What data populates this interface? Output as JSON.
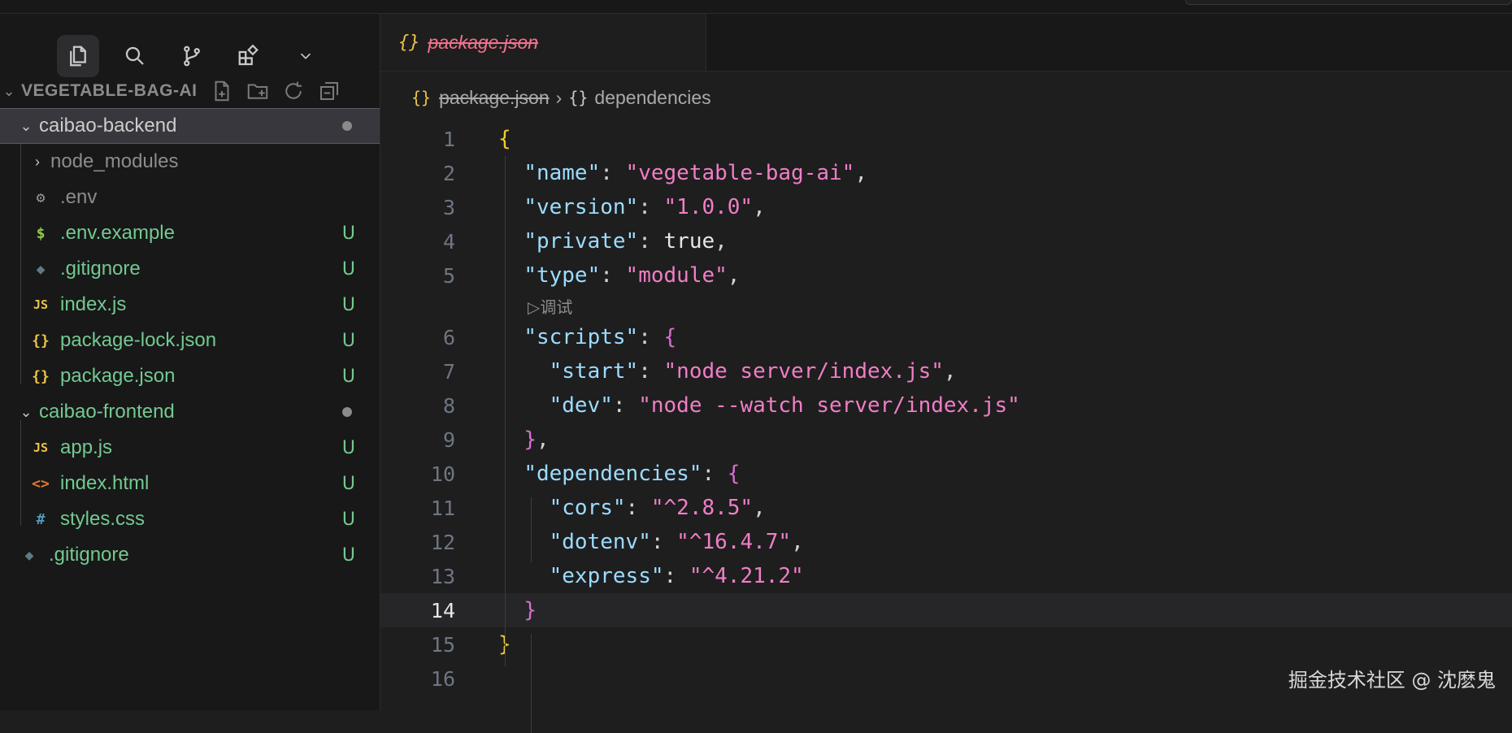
{
  "explorer": {
    "title": "VEGETABLE-BAG-AI"
  },
  "tree": [
    {
      "label": "caibao-backend",
      "badge": "",
      "kind": "folder-open",
      "icon": "chevron-down",
      "level": 0,
      "selected": true,
      "dot": true
    },
    {
      "label": "node_modules",
      "badge": "",
      "kind": "folder",
      "icon": "chevron-right",
      "level": 1,
      "dimmed": true
    },
    {
      "label": ".env",
      "badge": "",
      "kind": "file",
      "icon": "gear-icon",
      "level": 1,
      "dimmed": true
    },
    {
      "label": ".env.example",
      "badge": "U",
      "kind": "file",
      "icon": "dollar-icon",
      "level": 1
    },
    {
      "label": ".gitignore",
      "badge": "U",
      "kind": "file",
      "icon": "git-icon",
      "level": 1
    },
    {
      "label": "index.js",
      "badge": "U",
      "kind": "file",
      "icon": "js-icon",
      "level": 1
    },
    {
      "label": "package-lock.json",
      "badge": "U",
      "kind": "file",
      "icon": "json-icon",
      "level": 1
    },
    {
      "label": "package.json",
      "badge": "U",
      "kind": "file",
      "icon": "json-icon",
      "level": 1
    },
    {
      "label": "caibao-frontend",
      "badge": "",
      "kind": "folder-open",
      "icon": "chevron-down",
      "level": 0,
      "dot": true
    },
    {
      "label": "app.js",
      "badge": "U",
      "kind": "file",
      "icon": "js-icon",
      "level": 1
    },
    {
      "label": "index.html",
      "badge": "U",
      "kind": "file",
      "icon": "html-icon",
      "level": 1
    },
    {
      "label": "styles.css",
      "badge": "U",
      "kind": "file",
      "icon": "css-icon",
      "level": 1
    },
    {
      "label": ".gitignore",
      "badge": "U",
      "kind": "file",
      "icon": "git-icon",
      "level": 0
    }
  ],
  "tab": {
    "icon": "{}",
    "label": "package.json"
  },
  "breadcrumb": {
    "file_icon": "{}",
    "file": "package.json",
    "symbol_icon": "{}",
    "symbol": "dependencies"
  },
  "codelens": "▷调试",
  "lines": [
    {
      "n": "1",
      "tokens": [
        [
          "b1",
          "{"
        ]
      ]
    },
    {
      "n": "2",
      "tokens": [
        [
          "p",
          "  "
        ],
        [
          "k",
          "\"name\""
        ],
        [
          "p",
          ": "
        ],
        [
          "s",
          "\"vegetable-bag-ai\""
        ],
        [
          "p",
          ","
        ]
      ]
    },
    {
      "n": "3",
      "tokens": [
        [
          "p",
          "  "
        ],
        [
          "k",
          "\"version\""
        ],
        [
          "p",
          ": "
        ],
        [
          "s",
          "\"1.0.0\""
        ],
        [
          "p",
          ","
        ]
      ]
    },
    {
      "n": "4",
      "tokens": [
        [
          "p",
          "  "
        ],
        [
          "k",
          "\"private\""
        ],
        [
          "p",
          ": "
        ],
        [
          "v",
          "true"
        ],
        [
          "p",
          ","
        ]
      ]
    },
    {
      "n": "5",
      "tokens": [
        [
          "p",
          "  "
        ],
        [
          "k",
          "\"type\""
        ],
        [
          "p",
          ": "
        ],
        [
          "s",
          "\"module\""
        ],
        [
          "p",
          ","
        ]
      ],
      "codelens_after": true
    },
    {
      "n": "6",
      "tokens": [
        [
          "p",
          "  "
        ],
        [
          "k",
          "\"scripts\""
        ],
        [
          "p",
          ": "
        ],
        [
          "b2",
          "{"
        ]
      ]
    },
    {
      "n": "7",
      "tokens": [
        [
          "p",
          "    "
        ],
        [
          "k",
          "\"start\""
        ],
        [
          "p",
          ": "
        ],
        [
          "s",
          "\"node server/index.js\""
        ],
        [
          "p",
          ","
        ]
      ]
    },
    {
      "n": "8",
      "tokens": [
        [
          "p",
          "    "
        ],
        [
          "k",
          "\"dev\""
        ],
        [
          "p",
          ": "
        ],
        [
          "s",
          "\"node --watch server/index.js\""
        ]
      ]
    },
    {
      "n": "9",
      "tokens": [
        [
          "p",
          "  "
        ],
        [
          "b2",
          "}"
        ],
        [
          "p",
          ","
        ]
      ]
    },
    {
      "n": "10",
      "tokens": [
        [
          "p",
          "  "
        ],
        [
          "k",
          "\"dependencies\""
        ],
        [
          "p",
          ": "
        ],
        [
          "b2",
          "{"
        ]
      ]
    },
    {
      "n": "11",
      "tokens": [
        [
          "p",
          "    "
        ],
        [
          "k",
          "\"cors\""
        ],
        [
          "p",
          ": "
        ],
        [
          "s",
          "\"^2.8.5\""
        ],
        [
          "p",
          ","
        ]
      ]
    },
    {
      "n": "12",
      "tokens": [
        [
          "p",
          "    "
        ],
        [
          "k",
          "\"dotenv\""
        ],
        [
          "p",
          ": "
        ],
        [
          "s",
          "\"^16.4.7\""
        ],
        [
          "p",
          ","
        ]
      ]
    },
    {
      "n": "13",
      "tokens": [
        [
          "p",
          "    "
        ],
        [
          "k",
          "\"express\""
        ],
        [
          "p",
          ": "
        ],
        [
          "s",
          "\"^4.21.2\""
        ]
      ]
    },
    {
      "n": "14",
      "tokens": [
        [
          "p",
          "  "
        ],
        [
          "b2",
          "}"
        ]
      ],
      "current": true
    },
    {
      "n": "15",
      "tokens": [
        [
          "b1",
          "}"
        ]
      ]
    },
    {
      "n": "16",
      "tokens": []
    }
  ],
  "watermark": "掘金技术社区 @ 沈麽鬼",
  "colors": {
    "badge": "#73c991",
    "key": "#9cdcfe",
    "string": "#f07ec5",
    "bracket_outer": "#f2cc30",
    "bracket_inner": "#d86fcf"
  }
}
